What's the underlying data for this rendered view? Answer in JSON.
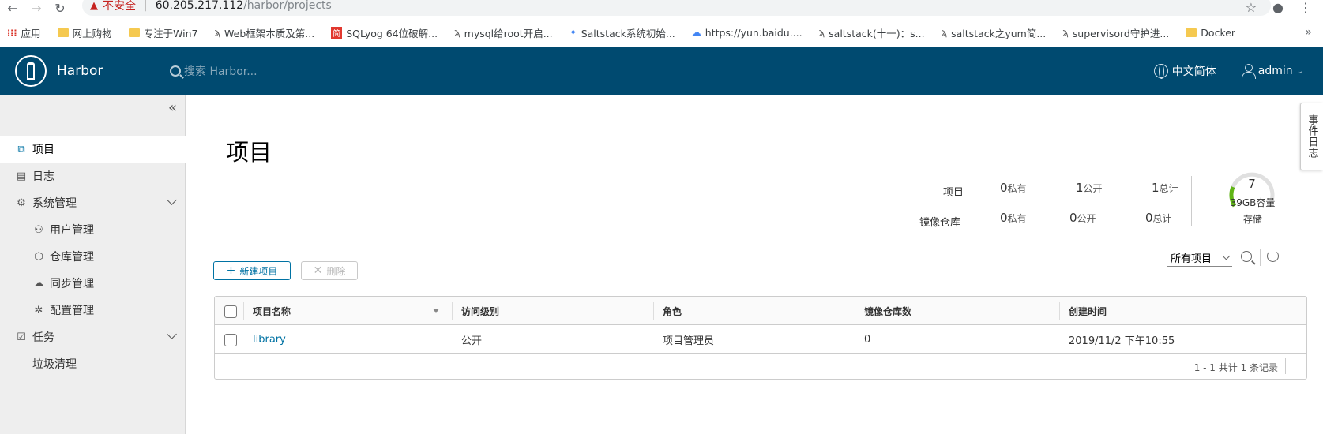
{
  "browser": {
    "insecure_label": "不安全",
    "url_host": "60.205.217.112",
    "url_path": "/harbor/projects",
    "bookmarks": [
      {
        "label": "应用",
        "icon": "apps-grid-icon"
      },
      {
        "label": "网上购物",
        "icon": "folder-icon"
      },
      {
        "label": "专注于Win7",
        "icon": "folder-icon"
      },
      {
        "label": "Web框架本质及第...",
        "icon": "fish-icon"
      },
      {
        "label": "SQLyog 64位破解...",
        "icon": "jian-icon"
      },
      {
        "label": "mysql给root开启...",
        "icon": "fish-icon"
      },
      {
        "label": "Saltstack系统初始...",
        "icon": "multicolor-icon"
      },
      {
        "label": "https://yun.baidu....",
        "icon": "baidu-cloud-icon"
      },
      {
        "label": "saltstack(十一)：s...",
        "icon": "fish-icon"
      },
      {
        "label": "saltstack之yum简...",
        "icon": "fish-icon"
      },
      {
        "label": "supervisord守护进...",
        "icon": "fish-icon"
      },
      {
        "label": "Docker",
        "icon": "folder-icon"
      }
    ]
  },
  "header": {
    "brand": "Harbor",
    "search_placeholder": "搜索 Harbor...",
    "language": "中文简体",
    "user": "admin"
  },
  "sidebar": {
    "items": [
      {
        "label": "项目",
        "icon": "projects-icon",
        "active": true
      },
      {
        "label": "日志",
        "icon": "log-icon"
      },
      {
        "label": "系统管理",
        "icon": "admin-icon",
        "expandable": true
      },
      {
        "label": "用户管理",
        "icon": "users-icon"
      },
      {
        "label": "仓库管理",
        "icon": "registry-icon"
      },
      {
        "label": "同步管理",
        "icon": "replication-icon"
      },
      {
        "label": "配置管理",
        "icon": "config-icon"
      },
      {
        "label": "任务",
        "icon": "tasks-icon",
        "expandable": true
      },
      {
        "label": "垃圾清理"
      }
    ]
  },
  "main": {
    "title": "项目",
    "stats": {
      "projects_label": "项目",
      "repos_label": "镜像仓库",
      "private_unit": "私有",
      "public_unit": "公开",
      "total_unit": "总计",
      "projects_private": "0",
      "projects_public": "1",
      "projects_total": "1",
      "repos_private": "0",
      "repos_public": "0",
      "repos_total": "0",
      "storage_value": "7",
      "storage_capacity": "39GB容量",
      "storage_label": "存储"
    },
    "new_project_label": "新建项目",
    "delete_label": "删除",
    "filter_selected": "所有项目",
    "table": {
      "columns": [
        "项目名称",
        "访问级别",
        "角色",
        "镜像仓库数",
        "创建时间"
      ],
      "rows": [
        {
          "name": "library",
          "access": "公开",
          "role": "项目管理员",
          "repo_count": "0",
          "created": "2019/11/2 下午10:55"
        }
      ],
      "footer": "1 - 1 共计 1 条记录"
    },
    "event_log_tab": "事件日志"
  },
  "colors": {
    "header_bg": "#004a70",
    "accent": "#0072a3",
    "sidebar_bg": "#eeeeee"
  }
}
